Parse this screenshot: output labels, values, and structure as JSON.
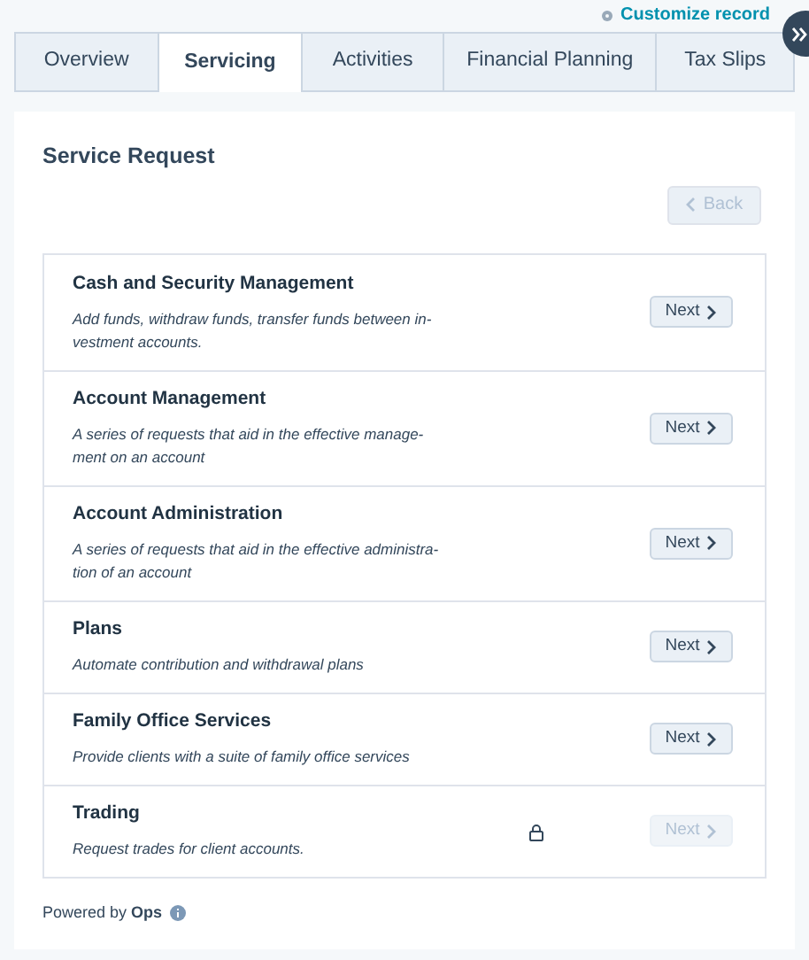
{
  "header": {
    "customize_link": "Customize record"
  },
  "tabs": [
    {
      "label": "Overview",
      "selected": false
    },
    {
      "label": "Servicing",
      "selected": true
    },
    {
      "label": "Activities",
      "selected": false
    },
    {
      "label": "Financial Planning",
      "selected": false
    },
    {
      "label": "Tax Slips",
      "selected": false
    }
  ],
  "card": {
    "title": "Service Request",
    "back_button": {
      "label": "Back",
      "disabled": true
    },
    "requests": [
      {
        "title": "Cash and Security Management",
        "description": [
          "Add funds, withdraw funds, transfer funds between in-",
          "vestment accounts."
        ],
        "button": "Next",
        "locked": false
      },
      {
        "title": "Account Management",
        "description": [
          "A series of requests that aid in the effective manage-",
          "ment on an account"
        ],
        "button": "Next",
        "locked": false
      },
      {
        "title": "Account Administration",
        "description": [
          "A series of requests that aid in the effective administra-",
          "tion of an account"
        ],
        "button": "Next",
        "locked": false
      },
      {
        "title": "Plans",
        "description": [
          "Automate contribution and withdrawal plans"
        ],
        "button": "Next",
        "locked": false
      },
      {
        "title": "Family Office Services",
        "description": [
          "Provide clients with a suite of family office services"
        ],
        "button": "Next",
        "locked": false
      },
      {
        "title": "Trading",
        "description": [
          "Request trades for client accounts."
        ],
        "button": "Next",
        "locked": true
      }
    ],
    "footer": "Powered by **Ops**"
  }
}
